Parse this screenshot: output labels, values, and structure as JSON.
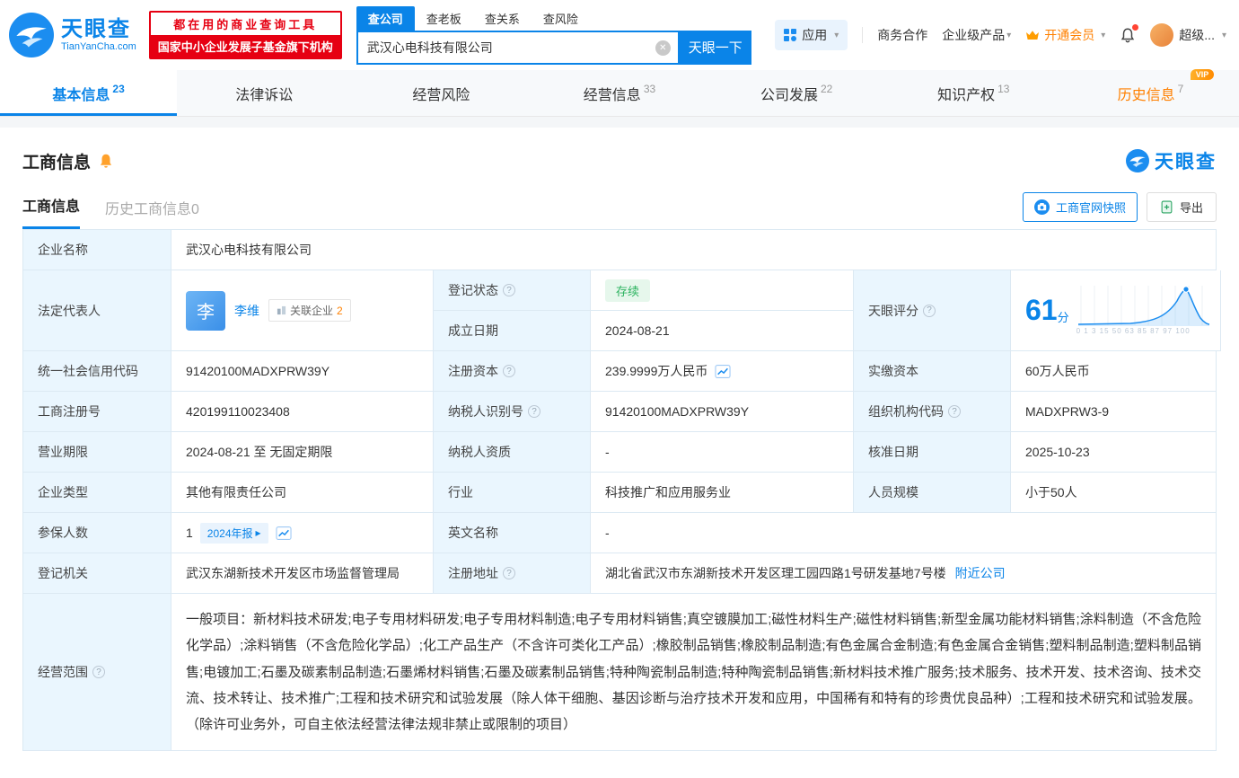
{
  "icons": {
    "chevron_down": "▾",
    "clear": "✕",
    "arrow_right": "▸",
    "question": "?"
  },
  "header": {
    "logo": {
      "title": "天眼查",
      "subtitle": "TianYanCha.com"
    },
    "promo": {
      "line1": "都在用的商业查询工具",
      "line2": "国家中小企业发展子基金旗下机构"
    },
    "search": {
      "tabs": [
        {
          "label": "查公司"
        },
        {
          "label": "查老板"
        },
        {
          "label": "查关系"
        },
        {
          "label": "查风险"
        }
      ],
      "value": "武汉心电科技有限公司",
      "button": "天眼一下"
    },
    "nav": {
      "app": "应用",
      "cooperation": "商务合作",
      "enterprise": "企业级产品",
      "vip": "开通会员",
      "user": "超级..."
    }
  },
  "tabs": [
    {
      "label": "基本信息",
      "count": "23"
    },
    {
      "label": "法律诉讼",
      "count": ""
    },
    {
      "label": "经营风险",
      "count": ""
    },
    {
      "label": "经营信息",
      "count": "33"
    },
    {
      "label": "公司发展",
      "count": "22"
    },
    {
      "label": "知识产权",
      "count": "13"
    },
    {
      "label": "历史信息",
      "count": "7",
      "vip": "VIP"
    }
  ],
  "section": {
    "title": "工商信息",
    "brand": "天眼查",
    "subtabs": [
      {
        "label": "工商信息"
      },
      {
        "label": "历史工商信息0"
      }
    ],
    "snapshot_button": "工商官网快照",
    "export_button": "导出"
  },
  "info": {
    "company_name": {
      "label": "企业名称",
      "value": "武汉心电科技有限公司"
    },
    "legal_rep": {
      "label": "法定代表人",
      "avatar": "李",
      "name": "李维",
      "related_label": "关联企业",
      "related_count": "2"
    },
    "reg_status": {
      "label": "登记状态",
      "value": "存续"
    },
    "est_date": {
      "label": "成立日期",
      "value": "2024-08-21"
    },
    "score": {
      "label": "天眼评分",
      "value": "61",
      "unit": "分",
      "axis": "0 1 3 15 50 63 85 87 97 100"
    },
    "credit_code": {
      "label": "统一社会信用代码",
      "value": "91420100MADXPRW39Y"
    },
    "reg_capital": {
      "label": "注册资本",
      "value": "239.9999万人民币"
    },
    "paid_capital": {
      "label": "实缴资本",
      "value": "60万人民币"
    },
    "reg_number": {
      "label": "工商注册号",
      "value": "420199110023408"
    },
    "taxpayer_id": {
      "label": "纳税人识别号",
      "value": "91420100MADXPRW39Y"
    },
    "org_code": {
      "label": "组织机构代码",
      "value": "MADXPRW3-9"
    },
    "business_term": {
      "label": "营业期限",
      "value": "2024-08-21 至 无固定期限"
    },
    "taxpayer_qual": {
      "label": "纳税人资质",
      "value": "-"
    },
    "approval_date": {
      "label": "核准日期",
      "value": "2025-10-23"
    },
    "company_type": {
      "label": "企业类型",
      "value": "其他有限责任公司"
    },
    "industry": {
      "label": "行业",
      "value": "科技推广和应用服务业"
    },
    "staff_size": {
      "label": "人员规模",
      "value": "小于50人"
    },
    "insured": {
      "label": "参保人数",
      "value": "1",
      "badge": "2024年报"
    },
    "english_name": {
      "label": "英文名称",
      "value": "-"
    },
    "reg_authority": {
      "label": "登记机关",
      "value": "武汉东湖新技术开发区市场监督管理局"
    },
    "reg_address": {
      "label": "注册地址",
      "value": "湖北省武汉市东湖新技术开发区理工园四路1号研发基地7号楼",
      "link": "附近公司"
    },
    "business_scope": {
      "label": "经营范围",
      "value": "一般项目：新材料技术研发;电子专用材料研发;电子专用材料制造;电子专用材料销售;真空镀膜加工;磁性材料生产;磁性材料销售;新型金属功能材料销售;涂料制造（不含危险化学品）;涂料销售（不含危险化学品）;化工产品生产（不含许可类化工产品）;橡胶制品销售;橡胶制品制造;有色金属合金制造;有色金属合金销售;塑料制品制造;塑料制品销售;电镀加工;石墨及碳素制品制造;石墨烯材料销售;石墨及碳素制品销售;特种陶瓷制品制造;特种陶瓷制品销售;新材料技术推广服务;技术服务、技术开发、技术咨询、技术交流、技术转让、技术推广;工程和技术研究和试验发展（除人体干细胞、基因诊断与治疗技术开发和应用，中国稀有和特有的珍贵优良品种）;工程和技术研究和试验发展。（除许可业务外，可自主依法经营法律法规非禁止或限制的项目）"
    }
  },
  "colors": {
    "brand_blue": "#0a84e8",
    "promo_red": "#e60012",
    "vip_orange": "#ff8000",
    "status_green": "#2cb35f",
    "label_bg": "#eaf6fe",
    "table_border": "#dce9f3"
  }
}
